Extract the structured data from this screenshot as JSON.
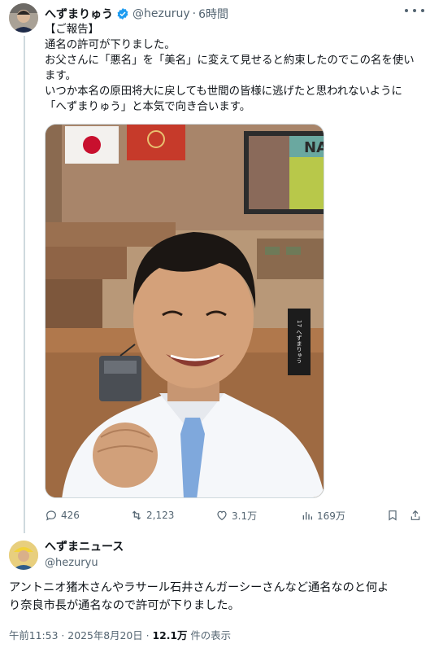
{
  "tweet": {
    "display_name": "へずまりゅう",
    "handle": "@hezuruy",
    "separator": "·",
    "time": "6時間",
    "lines": [
      "【ご報告】",
      "通名の許可が下りました。",
      "お父さんに「悪名」を「美名」に変えて見せると約束したのでこの名を使い",
      "ます。",
      "いつか本名の原田将大に戻しても世間の皆様に逃げたと思われないように",
      "「へずまりゅう」と本気で向き合います。"
    ],
    "image_alt": "議場でガッツポーズをする男性のセルフィー",
    "nameplate": "17 へずまりゅう",
    "screen_text": "NA",
    "stats": {
      "replies": "426",
      "reposts": "2,123",
      "likes": "3.1万",
      "views": "169万"
    }
  },
  "reply": {
    "display_name": "へずまニュース",
    "handle": "@hezuryu",
    "lines": [
      "アントニオ猪木さんやラサール石井さんガーシーさんなど通名なのと何よ",
      "り奈良市長が通名なので許可が下りました。"
    ],
    "timestamp": "午前11:53 · 2025年8月20日 · ",
    "views_count": "12.1万",
    "views_label": " 件の表示"
  },
  "colors": {
    "verified": "#1d9bf0",
    "secondary_text": "#536471",
    "thread_line": "#cfd9de"
  },
  "icons": [
    "verified-badge-icon",
    "more-icon",
    "reply-icon",
    "repost-icon",
    "like-icon",
    "views-icon",
    "bookmark-icon",
    "share-icon"
  ]
}
